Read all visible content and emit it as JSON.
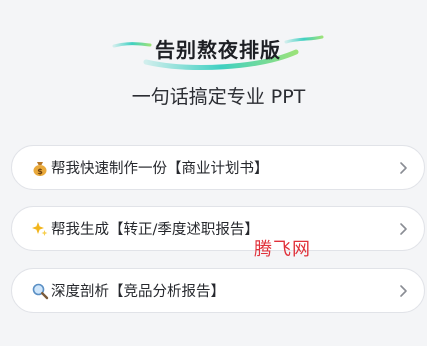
{
  "header": {
    "title": "告别熬夜排版",
    "subtitle": "一句话搞定专业 PPT"
  },
  "options": [
    {
      "icon": "money-bag-icon",
      "label": "帮我快速制作一份【商业计划书】"
    },
    {
      "icon": "sparkle-icon",
      "label": "帮我生成【转正/季度述职报告】"
    },
    {
      "icon": "magnifier-icon",
      "label": "深度剖析【竞品分析报告】"
    }
  ],
  "watermark": "腾飞网",
  "colors": {
    "background": "#f4f5f7",
    "accent_teal": "#3fd0c2",
    "accent_green": "#7fe08a",
    "watermark_red": "#e0313a"
  }
}
